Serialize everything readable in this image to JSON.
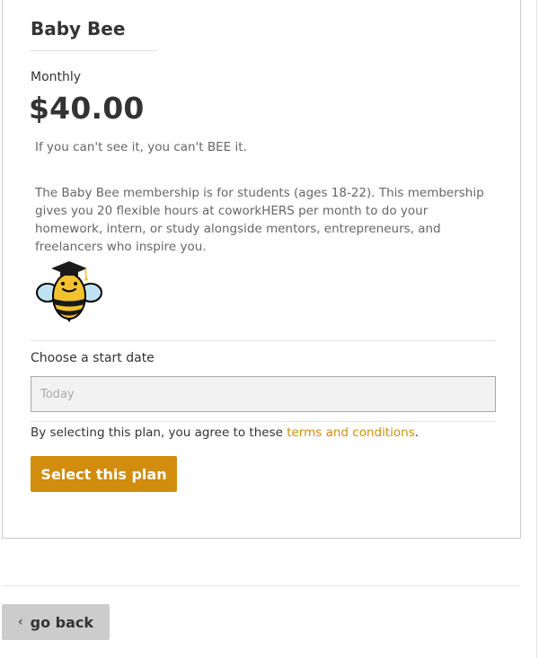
{
  "plan": {
    "title": "Baby Bee",
    "period": "Monthly",
    "price": "$40.00",
    "tagline": "If you can't see it, you can't BEE it.",
    "description": "The Baby Bee membership is for students (ages 18-22). This membership gives you 20 flexible hours at coworkHERS per month to do your homework, intern, or study alongside mentors, entrepreneurs, and freelancers who inspire you.",
    "image_icon": "graduate-bee-icon"
  },
  "start_date": {
    "label": "Choose a start date",
    "placeholder": "Today",
    "value": ""
  },
  "terms": {
    "prefix": "By selecting this plan, you agree to these ",
    "link_text": "terms and conditions",
    "suffix": "."
  },
  "actions": {
    "select_label": "Select this plan",
    "back_label": "go back",
    "back_icon": "chevron-left-icon"
  },
  "colors": {
    "accent": "#d28d0e",
    "back_button": "#cccccc"
  }
}
